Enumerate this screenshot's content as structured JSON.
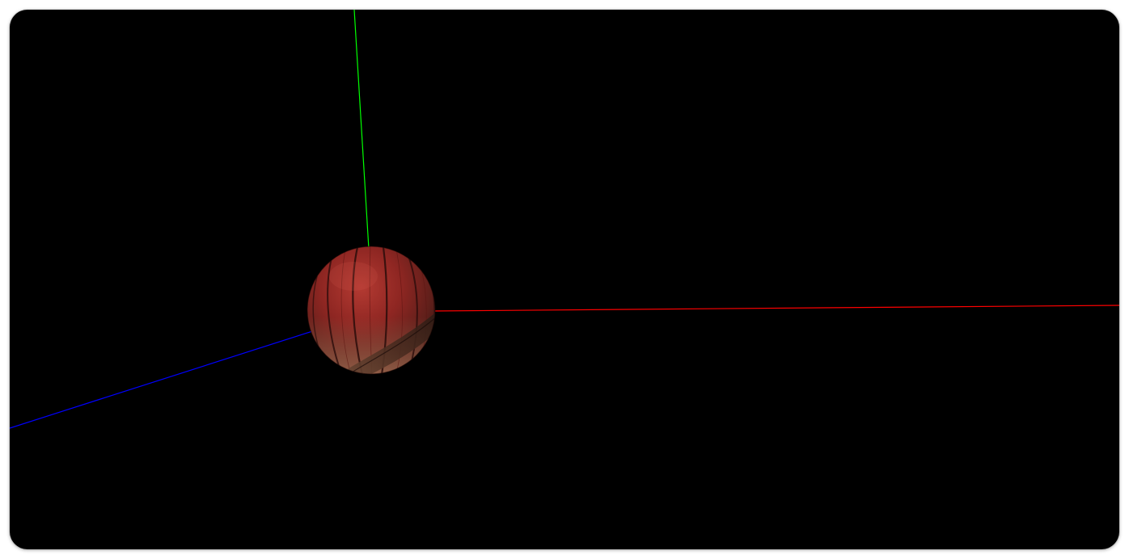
{
  "scene": {
    "background_color": "#000000",
    "axes": {
      "x_axis": {
        "color": "#ff0000"
      },
      "y_axis": {
        "color": "#00ff00"
      },
      "z_axis": {
        "color": "#0000ff"
      }
    },
    "object": {
      "shape": "sphere",
      "texture": "wood-grain",
      "base_color": "#8a1f1f",
      "shadow_color": "#4a2a1e"
    }
  }
}
